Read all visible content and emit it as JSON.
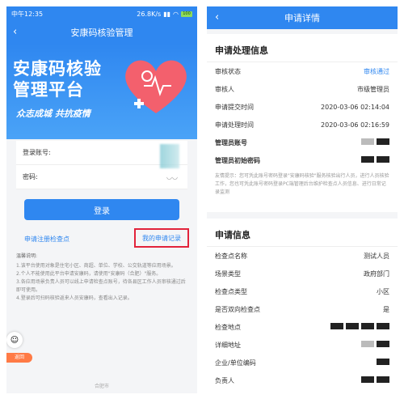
{
  "left": {
    "status": {
      "time": "中午12:35",
      "speed": "26.8K/s",
      "battery": "100"
    },
    "nav": {
      "title": "安康码核验管理",
      "back": "‹"
    },
    "banner": {
      "title_line1": "安康码核验",
      "title_line2": "管理平台",
      "slogan": "众志成城 共抗疫情"
    },
    "form": {
      "account_label": "登录账号:",
      "password_label": "密码:"
    },
    "login_label": "登录",
    "register_link": "申请注册检查点",
    "my_requests_link": "我的申请记录",
    "notes": {
      "title": "温馨说明:",
      "items": [
        "1.该平台使用对象是住宅小区、商超、单位、学校、公交轨道等应用场景。",
        "2.个人不能使用此平台申请安康码，请使用\"安康码（合肥）\"服务。",
        "3.各应用场景负责人员可以线上申请检查点账号，待各县区工作人员审核通过后即可使用。",
        "4.登录后可扫码核验返来人员安康码，查看出入记录。"
      ]
    },
    "footer": "合肥市",
    "float_tag": "返回"
  },
  "right": {
    "nav": {
      "title": "申请详情",
      "back": "‹"
    },
    "section1": {
      "title": "申请处理信息",
      "rows": [
        {
          "label": "审核状态",
          "value": "审核通过"
        },
        {
          "label": "审核人",
          "value": "市级管理员"
        },
        {
          "label": "申请提交时间",
          "value": "2020-03-06 02:14:04"
        },
        {
          "label": "申请处理时间",
          "value": "2020-03-06 02:16:59"
        },
        {
          "label": "管理员账号",
          "value": ""
        },
        {
          "label": "管理员初始密码",
          "value": ""
        }
      ],
      "tip": "友情提示：您可凭此账号密码登录\"安康码核验\"服务核验出行人员，进行人员核验工作，您也可凭此账号密码登录PC端管理后台维护检查点人员信息、进行日常记录监测"
    },
    "section2": {
      "title": "申请信息",
      "rows": [
        {
          "label": "检查点名称",
          "value": "测试人员"
        },
        {
          "label": "场景类型",
          "value": "政府部门"
        },
        {
          "label": "检查点类型",
          "value": "小区"
        },
        {
          "label": "是否双向检查点",
          "value": "是"
        },
        {
          "label": "检查地点",
          "value": ""
        },
        {
          "label": "详细地址",
          "value": ""
        },
        {
          "label": "企业/单位编码",
          "value": ""
        },
        {
          "label": "负责人",
          "value": ""
        }
      ]
    }
  },
  "colors": {
    "primary": "#2f87f0",
    "highlight_border": "#e2233b"
  }
}
